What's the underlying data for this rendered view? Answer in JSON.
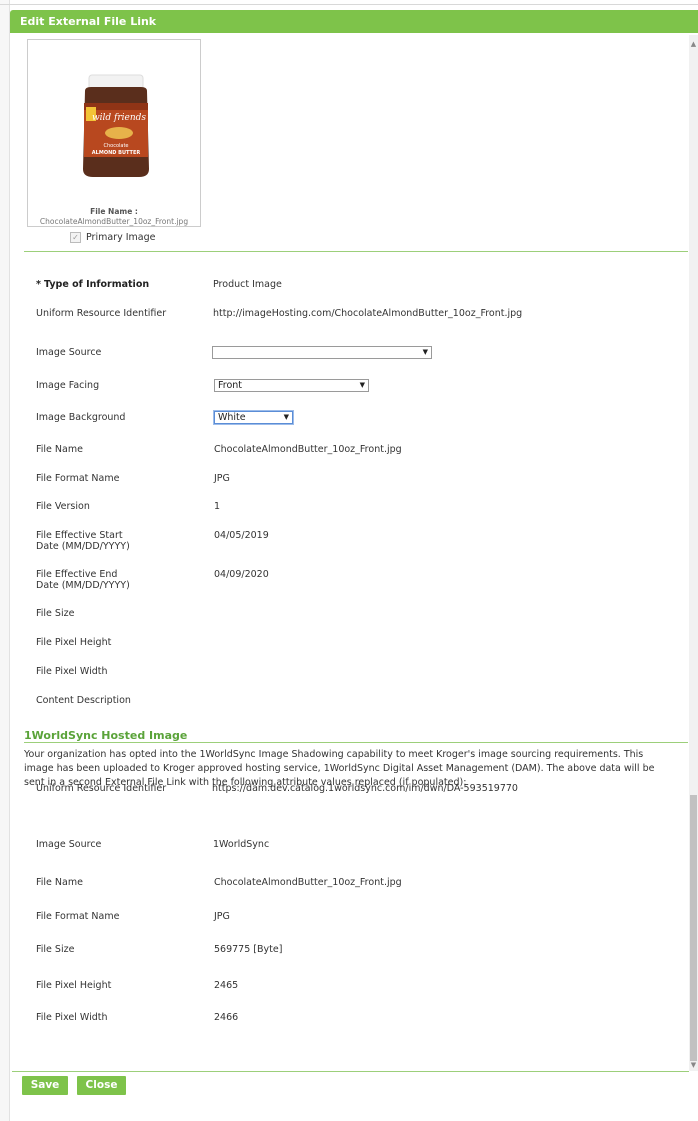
{
  "dialog": {
    "title": "Edit External File Link"
  },
  "preview": {
    "file_name_label": "File Name :",
    "file_name_value": "ChocolateAlmondButter_10oz_Front.jpg",
    "jar_brand": "wild friends",
    "jar_product_line1": "Chocolate",
    "jar_product_line2": "ALMOND BUTTER",
    "primary_image_label": "Primary Image",
    "primary_image_checked": true
  },
  "fields": {
    "type_of_information": {
      "label": "Type of Information",
      "required_mark": "*",
      "value": "Product Image"
    },
    "uri": {
      "label": "Uniform Resource Identifier",
      "value": "http://imageHosting.com/ChocolateAlmondButter_10oz_Front.jpg"
    },
    "image_source": {
      "label": "Image Source",
      "value": ""
    },
    "image_facing": {
      "label": "Image Facing",
      "value": "Front"
    },
    "image_background": {
      "label": "Image Background",
      "value": "White"
    },
    "file_name": {
      "label": "File Name",
      "value": "ChocolateAlmondButter_10oz_Front.jpg"
    },
    "file_format_name": {
      "label": "File Format Name",
      "value": "JPG"
    },
    "file_version": {
      "label": "File Version",
      "value": "1"
    },
    "effective_start": {
      "label_line1": "File Effective Start",
      "label_line2": "Date (MM/DD/YYYY)",
      "value": "04/05/2019"
    },
    "effective_end": {
      "label_line1": "File Effective End",
      "label_line2": "Date (MM/DD/YYYY)",
      "value": "04/09/2020"
    },
    "file_size": {
      "label": "File Size",
      "value": ""
    },
    "file_pixel_height": {
      "label": "File Pixel Height",
      "value": ""
    },
    "file_pixel_width": {
      "label": "File Pixel Width",
      "value": ""
    },
    "content_description": {
      "label": "Content Description",
      "value": ""
    }
  },
  "hosted": {
    "title": "1WorldSync Hosted Image",
    "notice": "Your organization has opted into the 1WorldSync Image Shadowing capability to meet Kroger's image sourcing requirements. This image has been uploaded to Kroger approved hosting service, 1WorldSync Digital Asset Management (DAM). The above data will be sent in a second External File Link with the following attribute values replaced (if populated):",
    "uri": {
      "label": "Uniform Resource Identifier",
      "value": "https://dam.dev.catalog.1worldsync.com/im/dwn/DA-593519770"
    },
    "image_source": {
      "label": "Image Source",
      "value": "1WorldSync"
    },
    "file_name": {
      "label": "File Name",
      "value": "ChocolateAlmondButter_10oz_Front.jpg"
    },
    "file_format_name": {
      "label": "File Format Name",
      "value": "JPG"
    },
    "file_size": {
      "label": "File Size",
      "value": "569775 [Byte]"
    },
    "file_pixel_height": {
      "label": "File Pixel Height",
      "value": "2465"
    },
    "file_pixel_width": {
      "label": "File Pixel Width",
      "value": "2466"
    }
  },
  "buttons": {
    "save": "Save",
    "close": "Close"
  },
  "colors": {
    "accent": "#7ec34a",
    "section_title": "#5aa339",
    "divider": "#9ccf7a"
  },
  "icons": {
    "dropdown": "triangle-down",
    "checkbox": "check",
    "scroll_up": "triangle-up",
    "scroll_down": "triangle-down"
  }
}
